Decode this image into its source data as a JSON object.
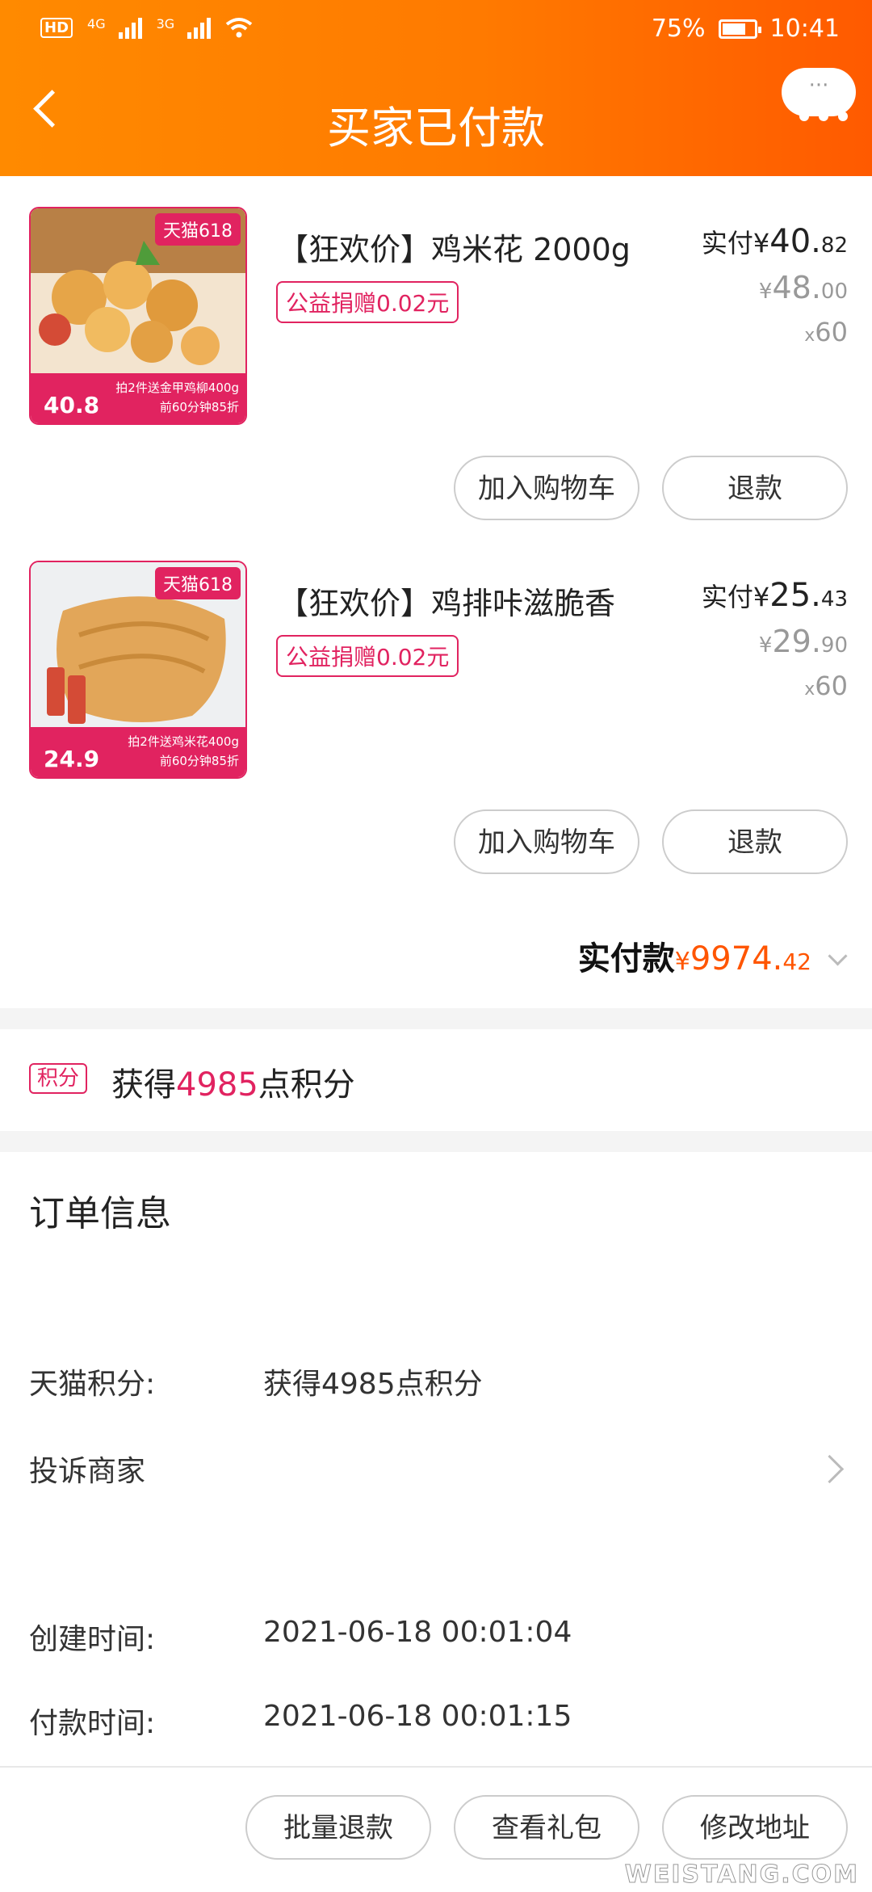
{
  "status_bar": {
    "hd": "HD",
    "net1": "4G",
    "net2": "3G",
    "battery_text": "75%",
    "battery_level": 0.75,
    "time": "10:41"
  },
  "nav": {
    "title": "买家已付款",
    "more": "···"
  },
  "products": [
    {
      "name": "【狂欢价】鸡米花 2000g",
      "charity": "公益捐赠0.02元",
      "paid_label": "实付",
      "currency": "¥",
      "paid_int": "40.",
      "paid_dec": "82",
      "orig_int": "48.",
      "orig_dec": "00",
      "qty_x": "x",
      "qty": "60",
      "thumb_tag": "天猫618",
      "thumb_price": "40.8",
      "thumb_promo1": "拍2件送金甲鸡柳400g",
      "thumb_promo2": "前60分钟85折",
      "add_cart": "加入购物车",
      "refund": "退款"
    },
    {
      "name": "【狂欢价】鸡排咔滋脆香",
      "charity": "公益捐赠0.02元",
      "paid_label": "实付",
      "currency": "¥",
      "paid_int": "25.",
      "paid_dec": "43",
      "orig_int": "29.",
      "orig_dec": "90",
      "qty_x": "x",
      "qty": "60",
      "thumb_tag": "天猫618",
      "thumb_price": "24.9",
      "thumb_promo1": "拍2件送鸡米花400g",
      "thumb_promo2": "前60分钟85折",
      "add_cart": "加入购物车",
      "refund": "退款"
    }
  ],
  "total": {
    "label": "实付款",
    "currency": "¥",
    "amount": "9974.",
    "decimal": "42"
  },
  "points": {
    "badge": "积分",
    "prefix": "获得",
    "number": "4985",
    "suffix": "点积分"
  },
  "order_info": {
    "title": "订单信息",
    "tmall_points_label": "天猫积分:",
    "tmall_points_value": "获得4985点积分",
    "complain_label": "投诉商家",
    "created_label": "创建时间:",
    "created_value": "2021-06-18 00:01:04",
    "paid_label": "付款时间:",
    "paid_value": "2021-06-18 00:01:15"
  },
  "bottom_actions": {
    "batch_refund": "批量退款",
    "view_gift": "查看礼包",
    "change_address": "修改地址"
  },
  "watermark": "WEISTANG.COM",
  "colors": {
    "header_orange": "#ff7a00",
    "accent_red": "#e12360",
    "price_orange": "#ff5500"
  }
}
